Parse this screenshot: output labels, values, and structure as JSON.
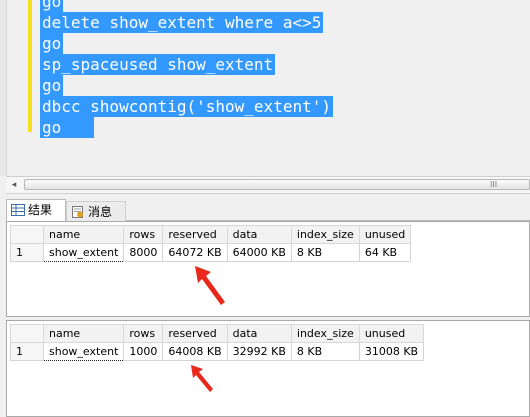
{
  "editor": {
    "lines": [
      "go",
      "delete show_extent where a<>5",
      "go",
      "sp_spaceused show_extent",
      "go",
      "dbcc showcontig('show_extent')",
      "go"
    ]
  },
  "scrollbar": {
    "left_arrow": "◂",
    "grip": "III"
  },
  "tabs": {
    "results_label": "结果",
    "messages_label": "消息"
  },
  "grid1": {
    "columns": [
      "name",
      "rows",
      "reserved",
      "data",
      "index_size",
      "unused"
    ],
    "rows": [
      {
        "num": "1",
        "name": "show_extent",
        "rows": "8000",
        "reserved": "64072 KB",
        "data": "64000 KB",
        "index_size": "8 KB",
        "unused": "64 KB"
      }
    ]
  },
  "grid2": {
    "columns": [
      "name",
      "rows",
      "reserved",
      "data",
      "index_size",
      "unused"
    ],
    "rows": [
      {
        "num": "1",
        "name": "show_extent",
        "rows": "1000",
        "reserved": "64008 KB",
        "data": "32992 KB",
        "index_size": "8 KB",
        "unused": "31008 KB"
      }
    ]
  },
  "annotation_color": "#e8281c"
}
